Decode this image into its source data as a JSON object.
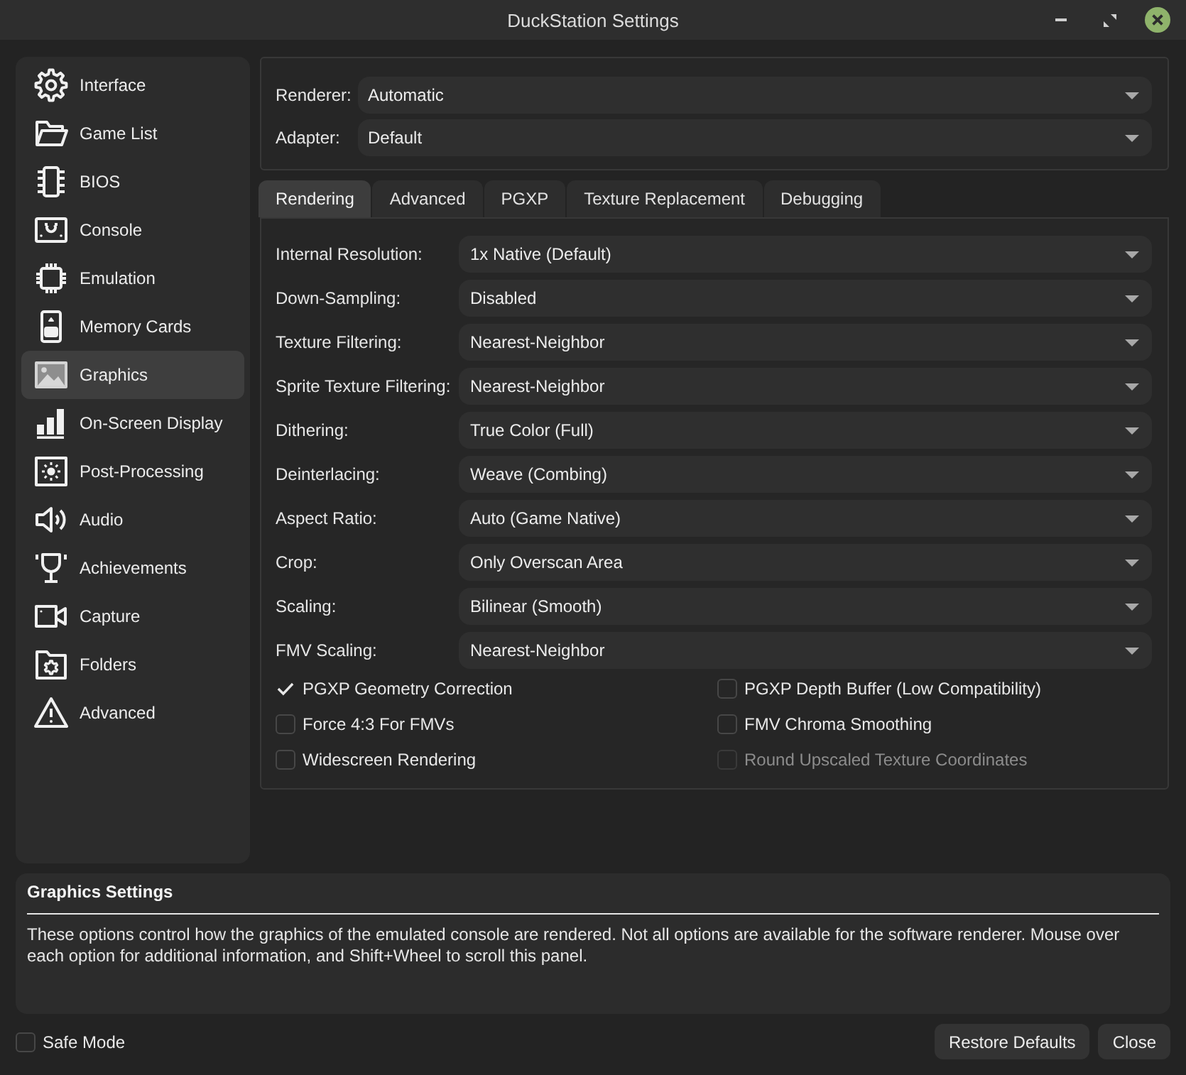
{
  "window": {
    "title": "DuckStation Settings"
  },
  "sidebar": {
    "items": [
      {
        "label": "Interface",
        "selected": false
      },
      {
        "label": "Game List",
        "selected": false
      },
      {
        "label": "BIOS",
        "selected": false
      },
      {
        "label": "Console",
        "selected": false
      },
      {
        "label": "Emulation",
        "selected": false
      },
      {
        "label": "Memory Cards",
        "selected": false
      },
      {
        "label": "Graphics",
        "selected": true
      },
      {
        "label": "On-Screen Display",
        "selected": false
      },
      {
        "label": "Post-Processing",
        "selected": false
      },
      {
        "label": "Audio",
        "selected": false
      },
      {
        "label": "Achievements",
        "selected": false
      },
      {
        "label": "Capture",
        "selected": false
      },
      {
        "label": "Folders",
        "selected": false
      },
      {
        "label": "Advanced",
        "selected": false
      }
    ]
  },
  "renderer_group": [
    {
      "label": "Renderer:",
      "value": "Automatic"
    },
    {
      "label": "Adapter:",
      "value": "Default"
    }
  ],
  "tabs": [
    {
      "label": "Rendering",
      "selected": true
    },
    {
      "label": "Advanced",
      "selected": false
    },
    {
      "label": "PGXP",
      "selected": false
    },
    {
      "label": "Texture Replacement",
      "selected": false
    },
    {
      "label": "Debugging",
      "selected": false
    }
  ],
  "rendering_settings": [
    {
      "label": "Internal Resolution:",
      "value": "1x Native (Default)"
    },
    {
      "label": "Down-Sampling:",
      "value": "Disabled"
    },
    {
      "label": "Texture Filtering:",
      "value": "Nearest-Neighbor"
    },
    {
      "label": "Sprite Texture Filtering:",
      "value": "Nearest-Neighbor"
    },
    {
      "label": "Dithering:",
      "value": "True Color (Full)"
    },
    {
      "label": "Deinterlacing:",
      "value": "Weave (Combing)"
    },
    {
      "label": "Aspect Ratio:",
      "value": "Auto (Game Native)"
    },
    {
      "label": "Crop:",
      "value": "Only Overscan Area"
    },
    {
      "label": "Scaling:",
      "value": "Bilinear (Smooth)"
    },
    {
      "label": "FMV Scaling:",
      "value": "Nearest-Neighbor"
    }
  ],
  "options": [
    {
      "label": "PGXP Geometry Correction",
      "checked": true,
      "disabled": false
    },
    {
      "label": "PGXP Depth Buffer (Low Compatibility)",
      "checked": false,
      "disabled": false
    },
    {
      "label": "Force 4:3 For FMVs",
      "checked": false,
      "disabled": false
    },
    {
      "label": "FMV Chroma Smoothing",
      "checked": false,
      "disabled": false
    },
    {
      "label": "Widescreen Rendering",
      "checked": false,
      "disabled": false
    },
    {
      "label": "Round Upscaled Texture Coordinates",
      "checked": false,
      "disabled": true
    }
  ],
  "info_panel": {
    "title": "Graphics Settings",
    "text": "These options control how the graphics of the emulated console are rendered. Not all options are available for the software renderer. Mouse over each option for additional information, and Shift+Wheel to scroll this panel."
  },
  "safe_mode": {
    "label": "Safe Mode",
    "checked": false
  },
  "buttons": [
    "Restore Defaults",
    "Close"
  ]
}
